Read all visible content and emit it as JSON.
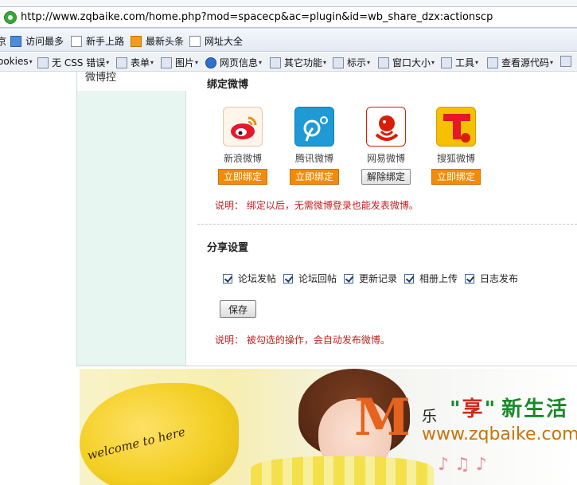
{
  "browser": {
    "url": "http://www.zqbaike.com/home.php?mod=spacecp&ac=plugin&id=wb_share_dzx:actionscp",
    "bookmarks": [
      {
        "label": "京",
        "icon": "page-icon"
      },
      {
        "label": "访问最多",
        "icon": "visited-icon"
      },
      {
        "label": "新手上路",
        "icon": "page-icon"
      },
      {
        "label": "最新头条",
        "icon": "rss-icon"
      },
      {
        "label": "网址大全",
        "icon": "page-icon"
      }
    ],
    "toolbar": [
      {
        "label": "ookies",
        "icon": "cookie-icon",
        "dropdown": true
      },
      {
        "label": "无 CSS 错误",
        "icon": "css-icon",
        "dropdown": true
      },
      {
        "label": "表单",
        "icon": "form-icon",
        "dropdown": true
      },
      {
        "label": "图片",
        "icon": "image-icon",
        "dropdown": true
      },
      {
        "label": "网页信息",
        "icon": "info-icon",
        "dropdown": true
      },
      {
        "label": "其它功能",
        "icon": "misc-icon",
        "dropdown": true
      },
      {
        "label": "标示",
        "icon": "pen-icon",
        "dropdown": true
      },
      {
        "label": "窗口大小",
        "icon": "window-icon",
        "dropdown": true
      },
      {
        "label": "工具",
        "icon": "tools-icon",
        "dropdown": true
      },
      {
        "label": "查看源代码",
        "icon": "source-icon",
        "dropdown": true
      }
    ]
  },
  "sidebar": {
    "tab_label": "微博控"
  },
  "bind_section": {
    "title": "绑定微博",
    "providers": [
      {
        "name": "新浪微博",
        "button": "立即绑定",
        "state": "unbound",
        "icon": "sina-weibo-icon",
        "color": "#e6162d"
      },
      {
        "name": "腾讯微博",
        "button": "立即绑定",
        "state": "unbound",
        "icon": "tencent-weibo-icon",
        "color": "#1e9ad6"
      },
      {
        "name": "网易微博",
        "button": "解除绑定",
        "state": "bound",
        "icon": "netease-weibo-icon",
        "color": "#d81e06"
      },
      {
        "name": "搜狐微博",
        "button": "立即绑定",
        "state": "unbound",
        "icon": "sohu-weibo-icon",
        "color": "#f5c000"
      }
    ],
    "note": "说明： 绑定以后，无需微博登录也能发表微博。"
  },
  "share_section": {
    "title": "分享设置",
    "options": [
      {
        "label": "论坛发帖",
        "checked": true
      },
      {
        "label": "论坛回帖",
        "checked": true
      },
      {
        "label": "更新记录",
        "checked": true
      },
      {
        "label": "相册上传",
        "checked": true
      },
      {
        "label": "日志发布",
        "checked": true
      }
    ],
    "save_label": "保存",
    "note": "说明： 被勾选的操作，会自动发布微博。"
  },
  "banner": {
    "heart_text": "welcome to here",
    "logo_letter": "M",
    "logo_le": "乐",
    "slogan_open": "\"",
    "slogan_red": "享",
    "slogan_close": "\"",
    "slogan_tail": "新生活",
    "url": "www.zqbaike.com",
    "notes": "♪ ♫ ♪"
  },
  "colors": {
    "accent_orange": "#f08c0a",
    "note_red": "#c02222",
    "sidebar_bg": "#e8f6f1"
  }
}
